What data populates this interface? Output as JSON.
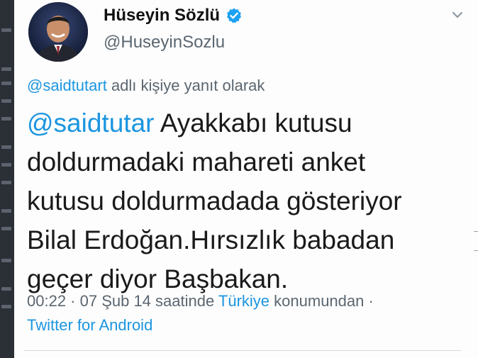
{
  "author": {
    "name": "Hüseyin Sözlü",
    "handle": "@HuseyinSozlu"
  },
  "reply_context": {
    "mention": "@saidtutart",
    "suffix": " adlı kişiye yanıt olarak"
  },
  "tweet": {
    "mention": "@saidtutar",
    "first_line_rest": " Ayakkabı kutusu",
    "lines": [
      "doldurmadaki mahareti anket",
      "kutusu doldurmadada gösteriyor",
      "Bilal Erdoğan.Hırsızlık babadan",
      "geçer diyor Başbakan."
    ]
  },
  "meta": {
    "timestamp": "00:22 · 07 Şub 14 saatinde ",
    "location": "Türkiye",
    "location_suffix": " konumundan ·",
    "source": "Twitter for Android"
  },
  "colors": {
    "link": "#1b95e0",
    "verified_badge": "#1da1f2",
    "secondary_text": "#5b6670"
  },
  "icons": {
    "verified": "verified-badge-icon",
    "more": "chevron-down-icon"
  }
}
